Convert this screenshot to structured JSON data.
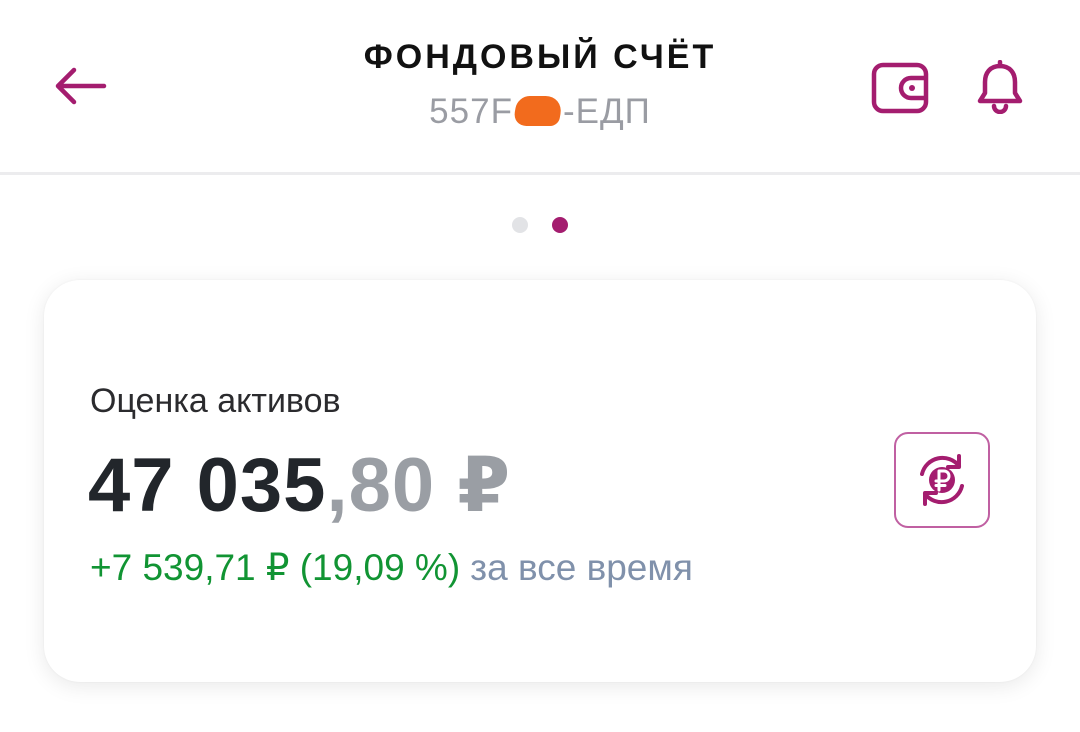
{
  "header": {
    "title": "ФОНДОВЫЙ СЧЁТ",
    "account_prefix": "557F",
    "account_suffix": "-ЕДП",
    "back_icon": "arrow-left-icon",
    "wallet_icon": "wallet-icon",
    "bell_icon": "bell-icon"
  },
  "pager": {
    "count": 2,
    "active_index": 1
  },
  "card": {
    "label": "Оценка активов",
    "total_integer": "47 035",
    "total_fraction": ",80 ₽",
    "change": "+7 539,71 ₽ (19,09 %)",
    "period": "за все время",
    "currency_icon": "ruble-exchange-icon"
  },
  "colors": {
    "accent": "#a41d6f",
    "gain": "#119433",
    "muted": "#9a9ea4",
    "period_text": "#8091ab",
    "redaction": "#f26b1d"
  }
}
